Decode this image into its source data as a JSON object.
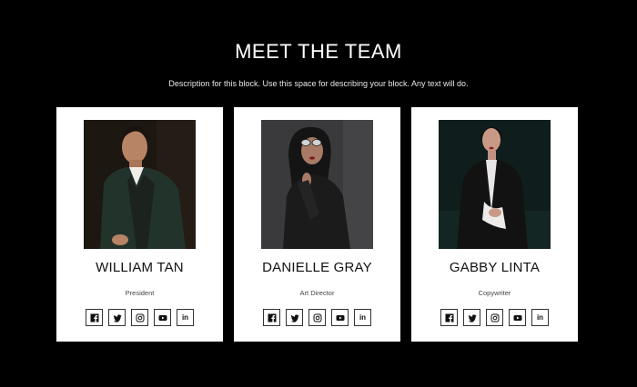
{
  "section": {
    "title": "MEET THE TEAM",
    "description": "Description for this block. Use this space for describing your block. Any text will do."
  },
  "members": [
    {
      "name": "WILLIAM TAN",
      "role": "President",
      "photo": "man-in-green-suit",
      "socials": [
        "facebook-icon",
        "twitter-icon",
        "instagram-icon",
        "youtube-icon",
        "linkedin-icon"
      ]
    },
    {
      "name": "DANIELLE GRAY",
      "role": "Art Director",
      "photo": "woman-with-sunglasses",
      "socials": [
        "facebook-icon",
        "twitter-icon",
        "instagram-icon",
        "youtube-icon",
        "linkedin-icon"
      ]
    },
    {
      "name": "GABBY LINTA",
      "role": "Copywriter",
      "photo": "woman-in-black-blazer",
      "socials": [
        "facebook-icon",
        "twitter-icon",
        "instagram-icon",
        "youtube-icon",
        "linkedin-icon"
      ]
    }
  ],
  "social_labels": {
    "linkedin": "in"
  },
  "colors": {
    "background": "#000000",
    "card": "#ffffff",
    "text_dark": "#111111"
  }
}
